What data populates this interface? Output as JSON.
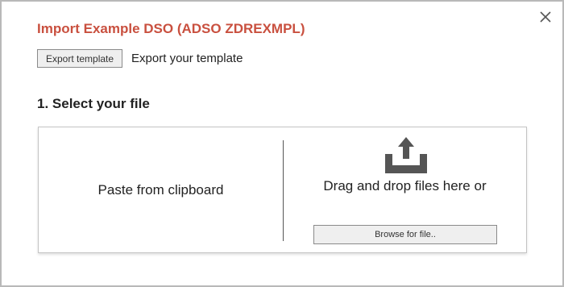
{
  "dialog": {
    "title": "Import  Example DSO (ADSO ZDREXMPL)",
    "close_icon": "close-icon"
  },
  "export": {
    "button_label": "Export template",
    "description": "Export your template"
  },
  "select_file": {
    "heading": "1. Select your file",
    "paste_label": "Paste from clipboard",
    "upload_icon": "upload-tray-icon",
    "drag_label": "Drag and drop files here or",
    "browse_label": "Browse for file.."
  },
  "colors": {
    "title": "#c9503f",
    "icon": "#555555"
  }
}
